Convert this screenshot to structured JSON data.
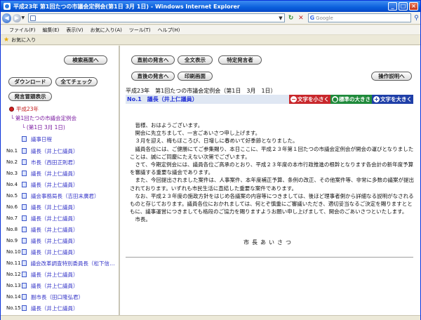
{
  "window": {
    "title": "平成23年 第1回たつの市議会定例会(第1日 3月 1日) - Windows Internet Explorer"
  },
  "navbar": {
    "address_value": "",
    "search_placeholder": "Google"
  },
  "menu": {
    "items": [
      "ファイル(F)",
      "編集(E)",
      "表示(V)",
      "お気に入り(A)",
      "ツール(T)",
      "ヘルプ(H)"
    ]
  },
  "favorites": {
    "label": "お気に入り"
  },
  "left": {
    "search_screen_btn": "検索画面へ",
    "download_btn": "ダウンロード",
    "check_all_btn": "全てチェック",
    "speaker_list_btn": "発言冒頭表示",
    "tree": {
      "year": "平成23年",
      "session": "第1回たつの市議会定例会",
      "day": "(第1日 3月 1日)"
    },
    "speakers": [
      {
        "no": "",
        "label": "議事日程"
      },
      {
        "no": "No.1",
        "label": "議長（井上仁議員）"
      },
      {
        "no": "No.2",
        "label": "市長（西田正則君）"
      },
      {
        "no": "No.3",
        "label": "議長（井上仁議員）"
      },
      {
        "no": "No.4",
        "label": "議長（井上仁議員）"
      },
      {
        "no": "No.5",
        "label": "議会事務局長（吉田末廣君）"
      },
      {
        "no": "No.6",
        "label": "議長（井上仁議員）"
      },
      {
        "no": "No.7",
        "label": "議長（井上仁議員）"
      },
      {
        "no": "No.8",
        "label": "議長（井上仁議員）"
      },
      {
        "no": "No.9",
        "label": "議長（井上仁議員）"
      },
      {
        "no": "No.10",
        "label": "議長（井上仁議員）"
      },
      {
        "no": "No.11",
        "label": "議会改革調査特別委員長（松下信一郎"
      },
      {
        "no": "No.12",
        "label": "議長（井上仁議員）"
      },
      {
        "no": "No.13",
        "label": "議長（井上仁議員）"
      },
      {
        "no": "No.14",
        "label": "副市長（田口隆弘君）"
      },
      {
        "no": "No.15",
        "label": "議長（井上仁議員）"
      }
    ]
  },
  "right": {
    "prev_btn": "直前の発言へ",
    "fulltext_btn": "全文表示",
    "specific_btn": "特定発言者",
    "next_btn": "直後の発言へ",
    "print_btn": "印刷画面",
    "help_btn": "操作説明へ",
    "doc_title": "平成23年　第1回たつの市議会定例会（第1日　3月　1日）",
    "speaker_heading": "No.1　議長（井上仁議員）",
    "font_small": "文字を小さく",
    "font_standard": "標準の大きさ",
    "font_large": "文字を大きく",
    "paragraphs": [
      "　皆様、おはようございます。",
      "　開会に先立ちまして、一言ごあいさつ申し上げます。",
      "　３月を迎え、梅もほころび、日増しに春めいて好季節となりました。",
      "　議員各位には、ご健勝にてご参集賜り、本日ここに、平成２３年第１回たつの市議会定例会が開会の運びとなりましたことは、誠にご同慶にたえない次第でございます。",
      "　さて、今期定例会には、議員各位ご高承のとおり、平成２３年度の本市行政推進の根幹となります各会計の新年度予算を審議する重要な議会であります。",
      "　また、今回提出されました案件は、人事案件、本年度補正予算、条例の改正、その他案件等、非常に多数の議案が提出されております。いずれも市民生活に直結した重要な案件であります。",
      "　なお、平成２３年度の施政方針をはじめ各議案の内容等につきましては、後ほど理事者側から詳細なる説明がなされるものと存じております。議員各位におかれましては、何とぞ慎重にご審議いただき、適切妥当なるご決定を賜りますとともに、議事運営につきましても格段のご協力を賜りますようお願い申し上げまして、開会のごあいさつといたします。",
      "　市長。"
    ],
    "caption": "市長あいさつ"
  }
}
